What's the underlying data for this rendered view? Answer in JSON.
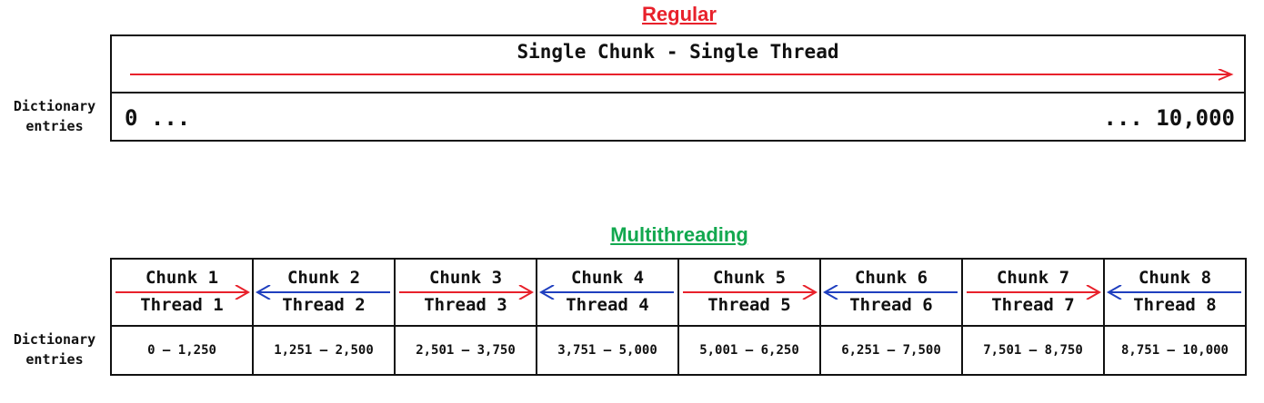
{
  "regular": {
    "heading": "Regular",
    "heading_color": "#e8212b",
    "title": "Single Chunk - Single Thread",
    "arrow_direction": "right",
    "arrow_color": "#e8212b",
    "dictionary_label": "Dictionary entries",
    "range_start": "0 ...",
    "range_end": "... 10,000"
  },
  "multithreading": {
    "heading": "Multithreading",
    "heading_color": "#12a84f",
    "dictionary_label": "Dictionary entries",
    "chunks": [
      {
        "chunk": "Chunk 1",
        "thread": "Thread 1",
        "range": "0 – 1,250",
        "direction": "right",
        "color": "#e8212b"
      },
      {
        "chunk": "Chunk 2",
        "thread": "Thread 2",
        "range": "1,251 – 2,500",
        "direction": "left",
        "color": "#1f3fbf"
      },
      {
        "chunk": "Chunk 3",
        "thread": "Thread 3",
        "range": "2,501 – 3,750",
        "direction": "right",
        "color": "#e8212b"
      },
      {
        "chunk": "Chunk 4",
        "thread": "Thread 4",
        "range": "3,751 – 5,000",
        "direction": "left",
        "color": "#1f3fbf"
      },
      {
        "chunk": "Chunk 5",
        "thread": "Thread 5",
        "range": "5,001 – 6,250",
        "direction": "right",
        "color": "#e8212b"
      },
      {
        "chunk": "Chunk 6",
        "thread": "Thread 6",
        "range": "6,251 – 7,500",
        "direction": "left",
        "color": "#1f3fbf"
      },
      {
        "chunk": "Chunk 7",
        "thread": "Thread 7",
        "range": "7,501 – 8,750",
        "direction": "right",
        "color": "#e8212b"
      },
      {
        "chunk": "Chunk 8",
        "thread": "Thread 8",
        "range": "8,751 – 10,000",
        "direction": "left",
        "color": "#1f3fbf"
      }
    ]
  }
}
